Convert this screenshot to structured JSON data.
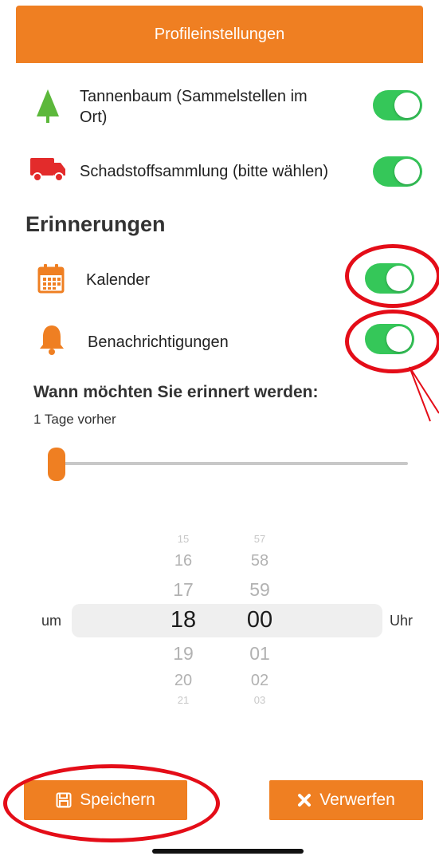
{
  "header": {
    "title": "Profileinstellungen"
  },
  "settings": [
    {
      "label_line1": "Tannenbaum (Sammelstellen im",
      "label_line2": "Ort)",
      "icon": "tree-icon",
      "enabled": true
    },
    {
      "label": "Schadstoffsammlung (bitte wählen)",
      "icon": "truck-icon",
      "enabled": true
    }
  ],
  "reminders": {
    "title": "Erinnerungen",
    "items": [
      {
        "label": "Kalender",
        "icon": "calendar-icon",
        "enabled": true
      },
      {
        "label": "Benachrichtigungen",
        "icon": "bell-icon",
        "enabled": true
      }
    ]
  },
  "when": {
    "question": "Wann möchten Sie erinnert werden:",
    "value_text": "1 Tage vorher",
    "slider_value": 1
  },
  "time_picker": {
    "prefix": "um",
    "suffix": "Uhr",
    "hours": [
      "15",
      "16",
      "17",
      "18",
      "19",
      "20",
      "21"
    ],
    "minutes": [
      "57",
      "58",
      "59",
      "00",
      "01",
      "02",
      "03"
    ],
    "selected_hour": "18",
    "selected_minute": "00"
  },
  "buttons": {
    "save": "Speichern",
    "discard": "Verwerfen"
  },
  "colors": {
    "accent": "#ef7f22",
    "toggle_on": "#35c759",
    "annotation": "#e40d18"
  }
}
